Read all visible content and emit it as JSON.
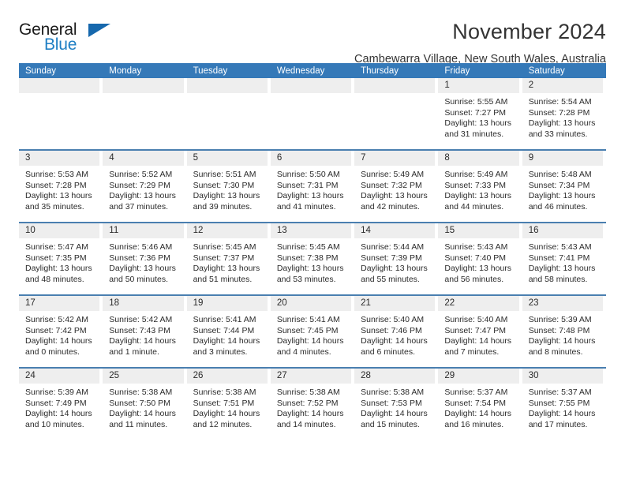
{
  "brand": {
    "word1": "General",
    "word2": "Blue",
    "triangle_color": "#1668ad",
    "blue_color": "#1f7fc4"
  },
  "header": {
    "title": "November 2024",
    "subtitle": "Cambewarra Village, New South Wales, Australia"
  },
  "theme": {
    "header_blue": "#3579b8",
    "row_separator": "#4a7fb0",
    "daynum_band": "#eeeeee",
    "text": "#2b2b2b"
  },
  "weekdays": [
    "Sunday",
    "Monday",
    "Tuesday",
    "Wednesday",
    "Thursday",
    "Friday",
    "Saturday"
  ],
  "weeks": [
    [
      {
        "day": "",
        "lines": []
      },
      {
        "day": "",
        "lines": []
      },
      {
        "day": "",
        "lines": []
      },
      {
        "day": "",
        "lines": []
      },
      {
        "day": "",
        "lines": []
      },
      {
        "day": "1",
        "lines": [
          "Sunrise: 5:55 AM",
          "Sunset: 7:27 PM",
          "Daylight: 13 hours",
          "and 31 minutes."
        ]
      },
      {
        "day": "2",
        "lines": [
          "Sunrise: 5:54 AM",
          "Sunset: 7:28 PM",
          "Daylight: 13 hours",
          "and 33 minutes."
        ]
      }
    ],
    [
      {
        "day": "3",
        "lines": [
          "Sunrise: 5:53 AM",
          "Sunset: 7:28 PM",
          "Daylight: 13 hours",
          "and 35 minutes."
        ]
      },
      {
        "day": "4",
        "lines": [
          "Sunrise: 5:52 AM",
          "Sunset: 7:29 PM",
          "Daylight: 13 hours",
          "and 37 minutes."
        ]
      },
      {
        "day": "5",
        "lines": [
          "Sunrise: 5:51 AM",
          "Sunset: 7:30 PM",
          "Daylight: 13 hours",
          "and 39 minutes."
        ]
      },
      {
        "day": "6",
        "lines": [
          "Sunrise: 5:50 AM",
          "Sunset: 7:31 PM",
          "Daylight: 13 hours",
          "and 41 minutes."
        ]
      },
      {
        "day": "7",
        "lines": [
          "Sunrise: 5:49 AM",
          "Sunset: 7:32 PM",
          "Daylight: 13 hours",
          "and 42 minutes."
        ]
      },
      {
        "day": "8",
        "lines": [
          "Sunrise: 5:49 AM",
          "Sunset: 7:33 PM",
          "Daylight: 13 hours",
          "and 44 minutes."
        ]
      },
      {
        "day": "9",
        "lines": [
          "Sunrise: 5:48 AM",
          "Sunset: 7:34 PM",
          "Daylight: 13 hours",
          "and 46 minutes."
        ]
      }
    ],
    [
      {
        "day": "10",
        "lines": [
          "Sunrise: 5:47 AM",
          "Sunset: 7:35 PM",
          "Daylight: 13 hours",
          "and 48 minutes."
        ]
      },
      {
        "day": "11",
        "lines": [
          "Sunrise: 5:46 AM",
          "Sunset: 7:36 PM",
          "Daylight: 13 hours",
          "and 50 minutes."
        ]
      },
      {
        "day": "12",
        "lines": [
          "Sunrise: 5:45 AM",
          "Sunset: 7:37 PM",
          "Daylight: 13 hours",
          "and 51 minutes."
        ]
      },
      {
        "day": "13",
        "lines": [
          "Sunrise: 5:45 AM",
          "Sunset: 7:38 PM",
          "Daylight: 13 hours",
          "and 53 minutes."
        ]
      },
      {
        "day": "14",
        "lines": [
          "Sunrise: 5:44 AM",
          "Sunset: 7:39 PM",
          "Daylight: 13 hours",
          "and 55 minutes."
        ]
      },
      {
        "day": "15",
        "lines": [
          "Sunrise: 5:43 AM",
          "Sunset: 7:40 PM",
          "Daylight: 13 hours",
          "and 56 minutes."
        ]
      },
      {
        "day": "16",
        "lines": [
          "Sunrise: 5:43 AM",
          "Sunset: 7:41 PM",
          "Daylight: 13 hours",
          "and 58 minutes."
        ]
      }
    ],
    [
      {
        "day": "17",
        "lines": [
          "Sunrise: 5:42 AM",
          "Sunset: 7:42 PM",
          "Daylight: 14 hours",
          "and 0 minutes."
        ]
      },
      {
        "day": "18",
        "lines": [
          "Sunrise: 5:42 AM",
          "Sunset: 7:43 PM",
          "Daylight: 14 hours",
          "and 1 minute."
        ]
      },
      {
        "day": "19",
        "lines": [
          "Sunrise: 5:41 AM",
          "Sunset: 7:44 PM",
          "Daylight: 14 hours",
          "and 3 minutes."
        ]
      },
      {
        "day": "20",
        "lines": [
          "Sunrise: 5:41 AM",
          "Sunset: 7:45 PM",
          "Daylight: 14 hours",
          "and 4 minutes."
        ]
      },
      {
        "day": "21",
        "lines": [
          "Sunrise: 5:40 AM",
          "Sunset: 7:46 PM",
          "Daylight: 14 hours",
          "and 6 minutes."
        ]
      },
      {
        "day": "22",
        "lines": [
          "Sunrise: 5:40 AM",
          "Sunset: 7:47 PM",
          "Daylight: 14 hours",
          "and 7 minutes."
        ]
      },
      {
        "day": "23",
        "lines": [
          "Sunrise: 5:39 AM",
          "Sunset: 7:48 PM",
          "Daylight: 14 hours",
          "and 8 minutes."
        ]
      }
    ],
    [
      {
        "day": "24",
        "lines": [
          "Sunrise: 5:39 AM",
          "Sunset: 7:49 PM",
          "Daylight: 14 hours",
          "and 10 minutes."
        ]
      },
      {
        "day": "25",
        "lines": [
          "Sunrise: 5:38 AM",
          "Sunset: 7:50 PM",
          "Daylight: 14 hours",
          "and 11 minutes."
        ]
      },
      {
        "day": "26",
        "lines": [
          "Sunrise: 5:38 AM",
          "Sunset: 7:51 PM",
          "Daylight: 14 hours",
          "and 12 minutes."
        ]
      },
      {
        "day": "27",
        "lines": [
          "Sunrise: 5:38 AM",
          "Sunset: 7:52 PM",
          "Daylight: 14 hours",
          "and 14 minutes."
        ]
      },
      {
        "day": "28",
        "lines": [
          "Sunrise: 5:38 AM",
          "Sunset: 7:53 PM",
          "Daylight: 14 hours",
          "and 15 minutes."
        ]
      },
      {
        "day": "29",
        "lines": [
          "Sunrise: 5:37 AM",
          "Sunset: 7:54 PM",
          "Daylight: 14 hours",
          "and 16 minutes."
        ]
      },
      {
        "day": "30",
        "lines": [
          "Sunrise: 5:37 AM",
          "Sunset: 7:55 PM",
          "Daylight: 14 hours",
          "and 17 minutes."
        ]
      }
    ]
  ]
}
